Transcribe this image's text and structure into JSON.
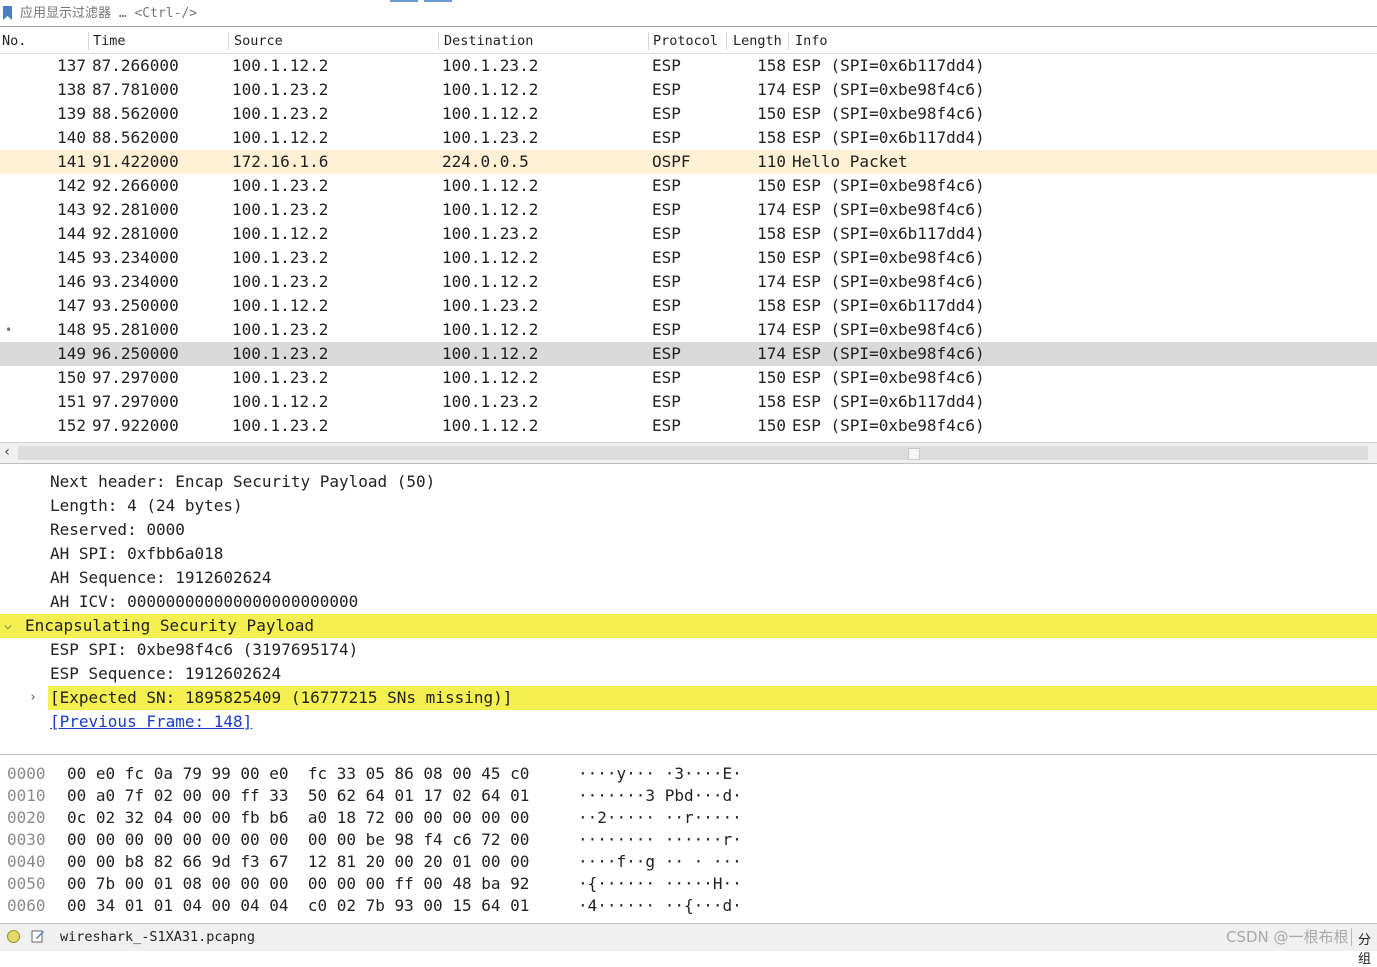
{
  "filter": {
    "placeholder": "应用显示过滤器 … <Ctrl-/>",
    "label": "应用显示过滤器 … <Ctrl-/>"
  },
  "columns": [
    "No.",
    "Time",
    "Source",
    "Destination",
    "Protocol",
    "Length",
    "Info"
  ],
  "packets": [
    {
      "no": "137",
      "time": "87.266000",
      "src": "100.1.12.2",
      "dst": "100.1.23.2",
      "proto": "ESP",
      "len": "158",
      "info": "ESP (SPI=0x6b117dd4)"
    },
    {
      "no": "138",
      "time": "87.781000",
      "src": "100.1.23.2",
      "dst": "100.1.12.2",
      "proto": "ESP",
      "len": "174",
      "info": "ESP (SPI=0xbe98f4c6)"
    },
    {
      "no": "139",
      "time": "88.562000",
      "src": "100.1.23.2",
      "dst": "100.1.12.2",
      "proto": "ESP",
      "len": "150",
      "info": "ESP (SPI=0xbe98f4c6)"
    },
    {
      "no": "140",
      "time": "88.562000",
      "src": "100.1.12.2",
      "dst": "100.1.23.2",
      "proto": "ESP",
      "len": "158",
      "info": "ESP (SPI=0x6b117dd4)"
    },
    {
      "no": "141",
      "time": "91.422000",
      "src": "172.16.1.6",
      "dst": "224.0.0.5",
      "proto": "OSPF",
      "len": "110",
      "info": "Hello Packet"
    },
    {
      "no": "142",
      "time": "92.266000",
      "src": "100.1.23.2",
      "dst": "100.1.12.2",
      "proto": "ESP",
      "len": "150",
      "info": "ESP (SPI=0xbe98f4c6)"
    },
    {
      "no": "143",
      "time": "92.281000",
      "src": "100.1.23.2",
      "dst": "100.1.12.2",
      "proto": "ESP",
      "len": "174",
      "info": "ESP (SPI=0xbe98f4c6)"
    },
    {
      "no": "144",
      "time": "92.281000",
      "src": "100.1.12.2",
      "dst": "100.1.23.2",
      "proto": "ESP",
      "len": "158",
      "info": "ESP (SPI=0x6b117dd4)"
    },
    {
      "no": "145",
      "time": "93.234000",
      "src": "100.1.23.2",
      "dst": "100.1.12.2",
      "proto": "ESP",
      "len": "150",
      "info": "ESP (SPI=0xbe98f4c6)"
    },
    {
      "no": "146",
      "time": "93.234000",
      "src": "100.1.23.2",
      "dst": "100.1.12.2",
      "proto": "ESP",
      "len": "174",
      "info": "ESP (SPI=0xbe98f4c6)"
    },
    {
      "no": "147",
      "time": "93.250000",
      "src": "100.1.12.2",
      "dst": "100.1.23.2",
      "proto": "ESP",
      "len": "158",
      "info": "ESP (SPI=0x6b117dd4)"
    },
    {
      "no": "148",
      "time": "95.281000",
      "src": "100.1.23.2",
      "dst": "100.1.12.2",
      "proto": "ESP",
      "len": "174",
      "info": "ESP (SPI=0xbe98f4c6)"
    },
    {
      "no": "149",
      "time": "96.250000",
      "src": "100.1.23.2",
      "dst": "100.1.12.2",
      "proto": "ESP",
      "len": "174",
      "info": "ESP (SPI=0xbe98f4c6)"
    },
    {
      "no": "150",
      "time": "97.297000",
      "src": "100.1.23.2",
      "dst": "100.1.12.2",
      "proto": "ESP",
      "len": "150",
      "info": "ESP (SPI=0xbe98f4c6)"
    },
    {
      "no": "151",
      "time": "97.297000",
      "src": "100.1.12.2",
      "dst": "100.1.23.2",
      "proto": "ESP",
      "len": "158",
      "info": "ESP (SPI=0x6b117dd4)"
    },
    {
      "no": "152",
      "time": "97.922000",
      "src": "100.1.23.2",
      "dst": "100.1.12.2",
      "proto": "ESP",
      "len": "150",
      "info": "ESP (SPI=0xbe98f4c6)"
    }
  ],
  "details": {
    "next_header": "Next header: Encap Security Payload (50)",
    "length": "Length: 4 (24 bytes)",
    "reserved": "Reserved: 0000",
    "ah_spi": "AH SPI: 0xfbb6a018",
    "ah_seq": "AH Sequence: 1912602624",
    "ah_icv": "AH ICV: 000000000000000000000000",
    "esp_header": "Encapsulating Security Payload",
    "esp_spi": "ESP SPI: 0xbe98f4c6 (3197695174)",
    "esp_seq": "ESP Sequence: 1912602624",
    "expected_sn": "[Expected SN: 1895825409 (16777215 SNs missing)]",
    "prev_frame": "[Previous Frame: 148]"
  },
  "bytes": [
    {
      "off": "0000",
      "hex": "00 e0 fc 0a 79 99 00 e0  fc 33 05 86 08 00 45 c0",
      "ascii": "····y··· ·3····E·"
    },
    {
      "off": "0010",
      "hex": "00 a0 7f 02 00 00 ff 33  50 62 64 01 17 02 64 01",
      "ascii": "·······3 Pbd···d·"
    },
    {
      "off": "0020",
      "hex": "0c 02 32 04 00 00 fb b6  a0 18 72 00 00 00 00 00",
      "ascii": "··2····· ··r·····"
    },
    {
      "off": "0030",
      "hex": "00 00 00 00 00 00 00 00  00 00 be 98 f4 c6 72 00",
      "ascii": "········ ······r·"
    },
    {
      "off": "0040",
      "hex": "00 00 b8 82 66 9d f3 67  12 81 20 00 20 01 00 00",
      "ascii": "····f··g ·· · ···"
    },
    {
      "off": "0050",
      "hex": "00 7b 00 01 08 00 00 00  00 00 00 ff 00 48 ba 92",
      "ascii": "·{······ ·····H··"
    },
    {
      "off": "0060",
      "hex": "00 34 01 01 04 00 04 04  c0 02 7b 93 00 15 64 01",
      "ascii": "·4······ ··{···d·"
    }
  ],
  "status": {
    "file": "wireshark_-S1XA31.pcapng",
    "watermark": "CSDN @一根布根",
    "right": "分组"
  },
  "colors": {
    "highlight": "#f4f052",
    "ospf_row": "#fdf0d5",
    "selected_row": "#d9d9d9",
    "link": "#1a3cc8"
  }
}
